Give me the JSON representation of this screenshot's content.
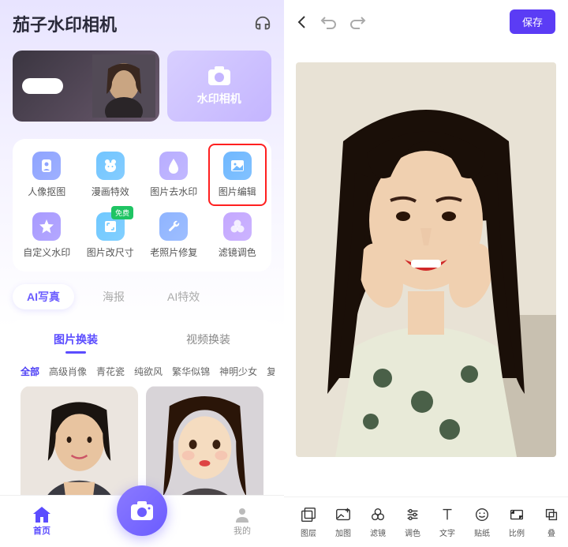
{
  "left": {
    "appTitle": "茄子水印相机",
    "banner": {
      "cameraLabel": "水印相机"
    },
    "features": [
      {
        "label": "人像抠图",
        "icon": "portrait",
        "bg": "#8fa4ff"
      },
      {
        "label": "漫画特效",
        "icon": "bear",
        "bg": "#72c5ff"
      },
      {
        "label": "图片去水印",
        "icon": "droplet",
        "bg": "#b8adff"
      },
      {
        "label": "图片编辑",
        "icon": "image",
        "bg": "#6fb8ff",
        "highlighted": true
      },
      {
        "label": "自定义水印",
        "icon": "star",
        "bg": "#a89aff"
      },
      {
        "label": "图片改尺寸",
        "icon": "resize",
        "bg": "#6fc8ff",
        "badge": "免费"
      },
      {
        "label": "老照片修复",
        "icon": "wrench",
        "bg": "#8fb4ff"
      },
      {
        "label": "滤镜调色",
        "icon": "filter",
        "bg": "#c4a8ff"
      }
    ],
    "secondaryTabs": [
      {
        "label": "AI写真",
        "active": true
      },
      {
        "label": "海报",
        "active": false
      },
      {
        "label": "AI特效",
        "active": false
      }
    ],
    "subTabs": [
      {
        "label": "图片换装",
        "active": true
      },
      {
        "label": "视频换装",
        "active": false
      }
    ],
    "filters": [
      "全部",
      "高级肖像",
      "青花瓷",
      "纯欲风",
      "繁华似锦",
      "神明少女",
      "复"
    ],
    "bottomNav": {
      "home": "首页",
      "mine": "我的"
    }
  },
  "right": {
    "saveLabel": "保存",
    "tools": [
      {
        "label": "图层",
        "icon": "layers"
      },
      {
        "label": "加图",
        "icon": "addimg"
      },
      {
        "label": "滤镜",
        "icon": "filter2"
      },
      {
        "label": "调色",
        "icon": "adjust"
      },
      {
        "label": "文字",
        "icon": "text"
      },
      {
        "label": "贴纸",
        "icon": "sticker"
      },
      {
        "label": "比例",
        "icon": "ratio"
      },
      {
        "label": "叠",
        "icon": "more"
      }
    ]
  }
}
